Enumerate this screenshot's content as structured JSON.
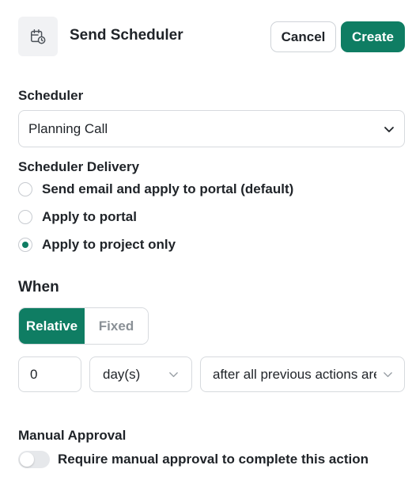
{
  "header": {
    "icon": "calendar-clock-icon",
    "title": "Send Scheduler",
    "cancel_label": "Cancel",
    "create_label": "Create"
  },
  "scheduler": {
    "label": "Scheduler",
    "selected": "Planning Call"
  },
  "delivery": {
    "label": "Scheduler Delivery",
    "options": [
      {
        "label": "Send email and apply to portal (default)",
        "checked": false
      },
      {
        "label": "Apply to portal",
        "checked": false
      },
      {
        "label": "Apply to project only",
        "checked": true
      }
    ]
  },
  "when": {
    "label": "When",
    "tabs": [
      "Relative",
      "Fixed"
    ],
    "active_tab": "Relative",
    "amount": "0",
    "unit": "day(s)",
    "relation": "after all previous actions are completed"
  },
  "approval": {
    "label": "Manual Approval",
    "toggle_label": "Require manual approval to complete this action",
    "enabled": false
  },
  "colors": {
    "accent": "#0f7d63"
  }
}
